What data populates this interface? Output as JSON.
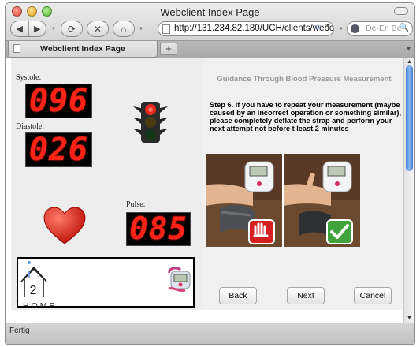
{
  "window": {
    "title": "Webclient Index Page"
  },
  "toolbar": {
    "url": "http://131.234.82.180/UCH/clients/webcl",
    "search_placeholder": "De-En Be"
  },
  "tabs": [
    {
      "label": "Webclient Index Page"
    }
  ],
  "newtab_label": "+",
  "status": {
    "text": "Fertig"
  },
  "monitor": {
    "systole_label": "Systole:",
    "systole_value": "096",
    "diastole_label": "Diastole:",
    "diastole_value": "026",
    "pulse_label": "Pulse:",
    "pulse_value": "085",
    "led_color": "#ff2318",
    "traffic_light_active": "red"
  },
  "logo": {
    "text": "HOME",
    "number": "2"
  },
  "guidance": {
    "title": "Guidance Through Blood Pressure Measurement",
    "step_text": "Step 6. If you have to repeat your measurement (maybe caused by an incorrect operation or something similar), please completely deflate the strap and perform your next attempt not before t least 2 minutes"
  },
  "buttons": {
    "back": "Back",
    "next": "Next",
    "cancel": "Cancel"
  },
  "icons": {
    "back": "back-arrow-icon",
    "forward": "forward-arrow-icon",
    "reload": "reload-icon",
    "stop": "stop-icon",
    "home": "home-icon",
    "bookmark": "star-icon",
    "wrong": "stop-hand-icon",
    "right": "checkmark-icon"
  }
}
